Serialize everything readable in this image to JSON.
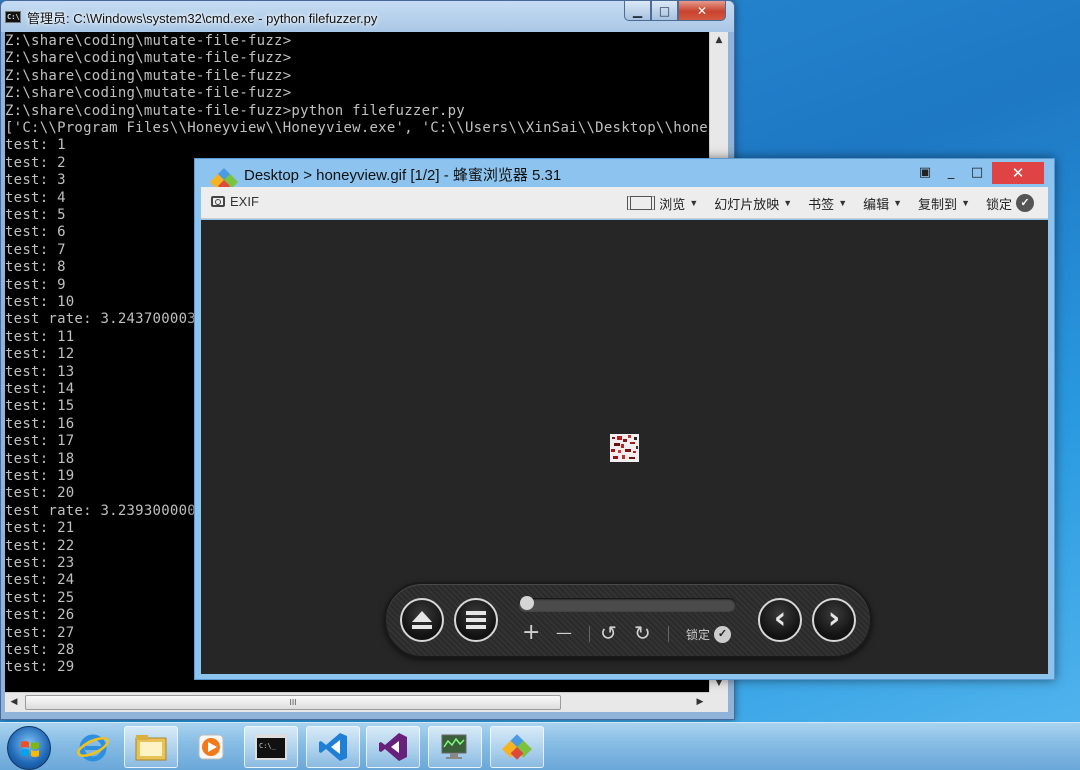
{
  "cmd": {
    "title": "管理员: C:\\Windows\\system32\\cmd.exe - python  filefuzzer.py",
    "icon": "cmd-icon",
    "lines": [
      "Z:\\share\\coding\\mutate-file-fuzz>",
      "Z:\\share\\coding\\mutate-file-fuzz>",
      "Z:\\share\\coding\\mutate-file-fuzz>",
      "Z:\\share\\coding\\mutate-file-fuzz>",
      "Z:\\share\\coding\\mutate-file-fuzz>python filefuzzer.py",
      "['C:\\\\Program Files\\\\Honeyview\\\\Honeyview.exe', 'C:\\\\Users\\\\XinSai\\\\Desktop\\\\hone",
      "test: 1",
      "test: 2",
      "test: 3",
      "test: 4",
      "test: 5",
      "test: 6",
      "test: 7",
      "test: 8",
      "test: 9",
      "test: 10",
      "test rate: 3.243700003",
      "test: 11",
      "test: 12",
      "test: 13",
      "test: 14",
      "test: 15",
      "test: 16",
      "test: 17",
      "test: 18",
      "test: 19",
      "test: 20",
      "test rate: 3.239300000",
      "test: 21",
      "test: 22",
      "test: 23",
      "test: 24",
      "test: 25",
      "test: 26",
      "test: 27",
      "test: 28",
      "test: 29"
    ],
    "hscroll_thumb_label": "III"
  },
  "honeyview": {
    "title": "Desktop > honeyview.gif [1/2] - 蜂蜜浏览器 5.31",
    "window_controls": {
      "minimize": "_",
      "maximize": "□",
      "close": "✕",
      "fullscreen_icon": "▣"
    },
    "toolbar": {
      "exif": "EXIF",
      "browse": "浏览",
      "slideshow": "幻灯片放映",
      "bookmarks": "书签",
      "edit": "编辑",
      "copy_to": "复制到",
      "lock": "锁定"
    },
    "controls": {
      "plus": "+",
      "minus": "—",
      "rotate_left": "↺",
      "rotate_right": "↻",
      "lock": "锁定",
      "prev": "‹",
      "next": "›",
      "progress": 0.0
    }
  },
  "taskbar": {
    "apps": [
      "ie-icon",
      "explorer-folder-icon",
      "media-player-icon",
      "cmd-icon",
      "vscode-icon",
      "visual-studio-icon",
      "device-monitor-icon",
      "honeyview-icon"
    ]
  }
}
